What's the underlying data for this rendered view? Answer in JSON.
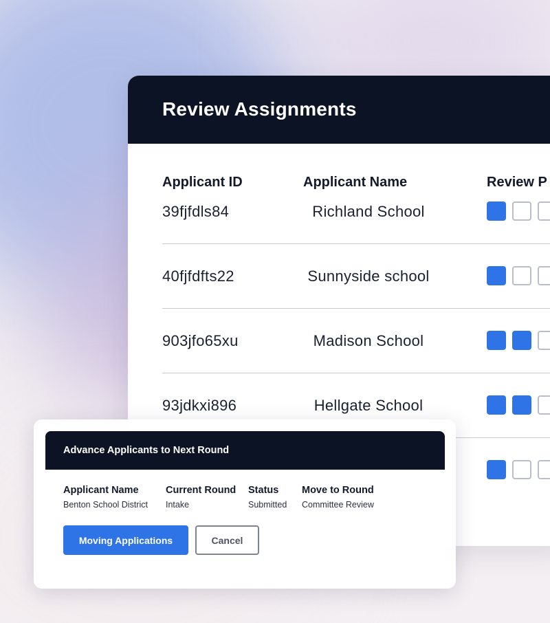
{
  "colors": {
    "header_bg": "#0c1325",
    "accent": "#2f74e6",
    "checkbox_off_border": "#b9bec8"
  },
  "review": {
    "title": "Review Assignments",
    "columns": [
      "Applicant ID",
      "Applicant Name",
      "Review P"
    ],
    "rows": [
      {
        "id": "39fjfdls84",
        "name": "Richland School",
        "progress": [
          true,
          false,
          false
        ]
      },
      {
        "id": "40fjfdfts22",
        "name": "Sunnyside school",
        "progress": [
          true,
          false,
          false
        ]
      },
      {
        "id": "903jfo65xu",
        "name": "Madison School",
        "progress": [
          true,
          true,
          false
        ]
      },
      {
        "id": "93jdkxi896",
        "name": "Hellgate School",
        "progress": [
          true,
          true,
          false
        ]
      },
      {
        "id": "",
        "name": "",
        "progress": [
          true,
          false,
          false
        ]
      }
    ]
  },
  "dialog": {
    "title": "Advance Applicants to Next Round",
    "fields": [
      {
        "label": "Applicant Name",
        "value": "Benton School District"
      },
      {
        "label": "Current Round",
        "value": "Intake"
      },
      {
        "label": "Status",
        "value": "Submitted"
      },
      {
        "label": "Move to Round",
        "value": "Committee Review"
      }
    ],
    "primary_button": "Moving Applications",
    "cancel_button": "Cancel"
  }
}
